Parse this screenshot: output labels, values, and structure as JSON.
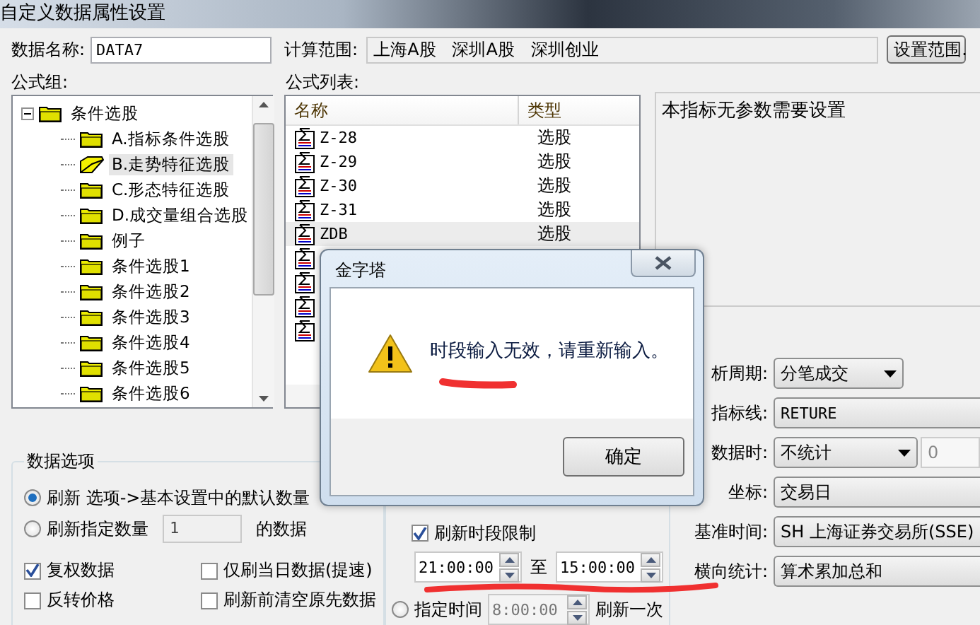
{
  "window": {
    "title": "自定义数据属性设置"
  },
  "header": {
    "name_label": "数据名称:",
    "name_value": "DATA7",
    "range_label": "计算范围:",
    "range_value": "上海A股   深圳A股   深圳创业",
    "range_button": "设置范围."
  },
  "formula_group": {
    "label": "公式组:",
    "tree": [
      {
        "label": "条件选股",
        "expanded": true,
        "children": [
          {
            "label": "A.指标条件选股",
            "selected": false
          },
          {
            "label": "B.走势特征选股",
            "selected": true
          },
          {
            "label": "C.形态特征选股",
            "selected": false
          },
          {
            "label": "D.成交量组合选股",
            "selected": false
          },
          {
            "label": "例子",
            "selected": false
          },
          {
            "label": "条件选股1",
            "selected": false
          },
          {
            "label": "条件选股2",
            "selected": false
          },
          {
            "label": "条件选股3",
            "selected": false
          },
          {
            "label": "条件选股4",
            "selected": false
          },
          {
            "label": "条件选股5",
            "selected": false
          },
          {
            "label": "条件选股6",
            "selected": false
          }
        ]
      }
    ]
  },
  "formula_list": {
    "label": "公式列表:",
    "columns": [
      "名称",
      "类型"
    ],
    "rows": [
      {
        "kind": "text",
        "name": "Z-28",
        "type": "选股",
        "selected": false
      },
      {
        "kind": "text",
        "name": "Z-29",
        "type": "选股",
        "selected": false
      },
      {
        "kind": "text",
        "name": "Z-30",
        "type": "选股",
        "selected": false
      },
      {
        "kind": "text",
        "name": "Z-31",
        "type": "选股",
        "selected": false
      },
      {
        "kind": "text",
        "name": "ZDB",
        "type": "选股",
        "selected": true
      },
      {
        "kind": "covered"
      },
      {
        "kind": "covered"
      },
      {
        "kind": "covered"
      },
      {
        "kind": "covered"
      }
    ]
  },
  "info": {
    "text": "本指标无参数需要设置"
  },
  "settings": [
    {
      "label": "析周期:",
      "kind": "dropdown",
      "value": "分笔成交"
    },
    {
      "label": "指标线:",
      "kind": "field",
      "value": "RETURE"
    },
    {
      "label": "数据时:",
      "kind": "dropdown_with_field",
      "value": "不统计",
      "extra": "0"
    },
    {
      "label": "坐标:",
      "kind": "field",
      "value": "交易日"
    },
    {
      "label": "基准时间:",
      "kind": "field",
      "value": "SH 上海证券交易所(SSE)"
    },
    {
      "label": "横向统计:",
      "kind": "field",
      "value": "算术累加总和"
    }
  ],
  "data_options": {
    "title": "数据选项",
    "radios": [
      {
        "label": "刷新 选项->基本设置中的默认数量",
        "selected": true
      },
      {
        "label": "刷新指定数量",
        "selected": false,
        "value": "1",
        "suffix": "的数据"
      }
    ],
    "checkboxes": [
      {
        "label": "复权数据",
        "checked": true
      },
      {
        "label": "仅刷当日数据(提速)",
        "checked": false
      },
      {
        "label": "反转价格",
        "checked": false
      },
      {
        "label": "刷新前清空原先数据",
        "checked": false
      }
    ]
  },
  "time_options": {
    "limit": {
      "label": "刷新时段限制",
      "checked": true
    },
    "start": "21:00:00",
    "to": "至",
    "end": "15:00:00",
    "fixed": {
      "label": "指定时间",
      "selected": false,
      "value": "8:00:00",
      "disabled": true,
      "suffix": "刷新一次"
    }
  },
  "alert": {
    "title": "金字塔",
    "message": "时段输入无效，请重新输入。",
    "button": "确定"
  }
}
